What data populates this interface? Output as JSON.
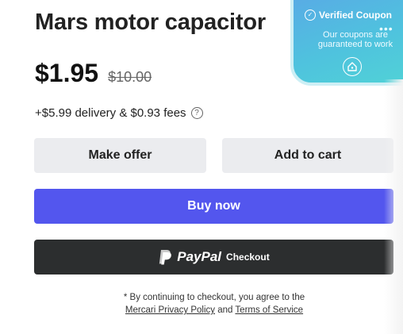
{
  "product": {
    "title": "Mars motor capacitor",
    "price": "$1.95",
    "original_price": "$10.00",
    "delivery": "+$5.99 delivery & $0.93 fees",
    "help_icon": "?"
  },
  "actions": {
    "make_offer": "Make offer",
    "add_to_cart": "Add to cart",
    "buy_now": "Buy now",
    "paypal_brand": "PayPal",
    "paypal_checkout": "Checkout"
  },
  "legal": {
    "prefix": "* By continuing to checkout, you agree to the",
    "privacy_link": "Mercari Privacy Policy",
    "and": "and",
    "terms_link": "Terms of Service"
  },
  "coupon": {
    "heading": "Verified Coupon",
    "body": "Our coupons are guaranteed to work",
    "dots": "•••"
  },
  "colors": {
    "buy_now": "#5356ee",
    "paypal": "#2c2e2f",
    "secondary_button": "#ebecef",
    "coupon_gradient_start": "#5aa8e6",
    "coupon_gradient_end": "#50d3d6"
  }
}
